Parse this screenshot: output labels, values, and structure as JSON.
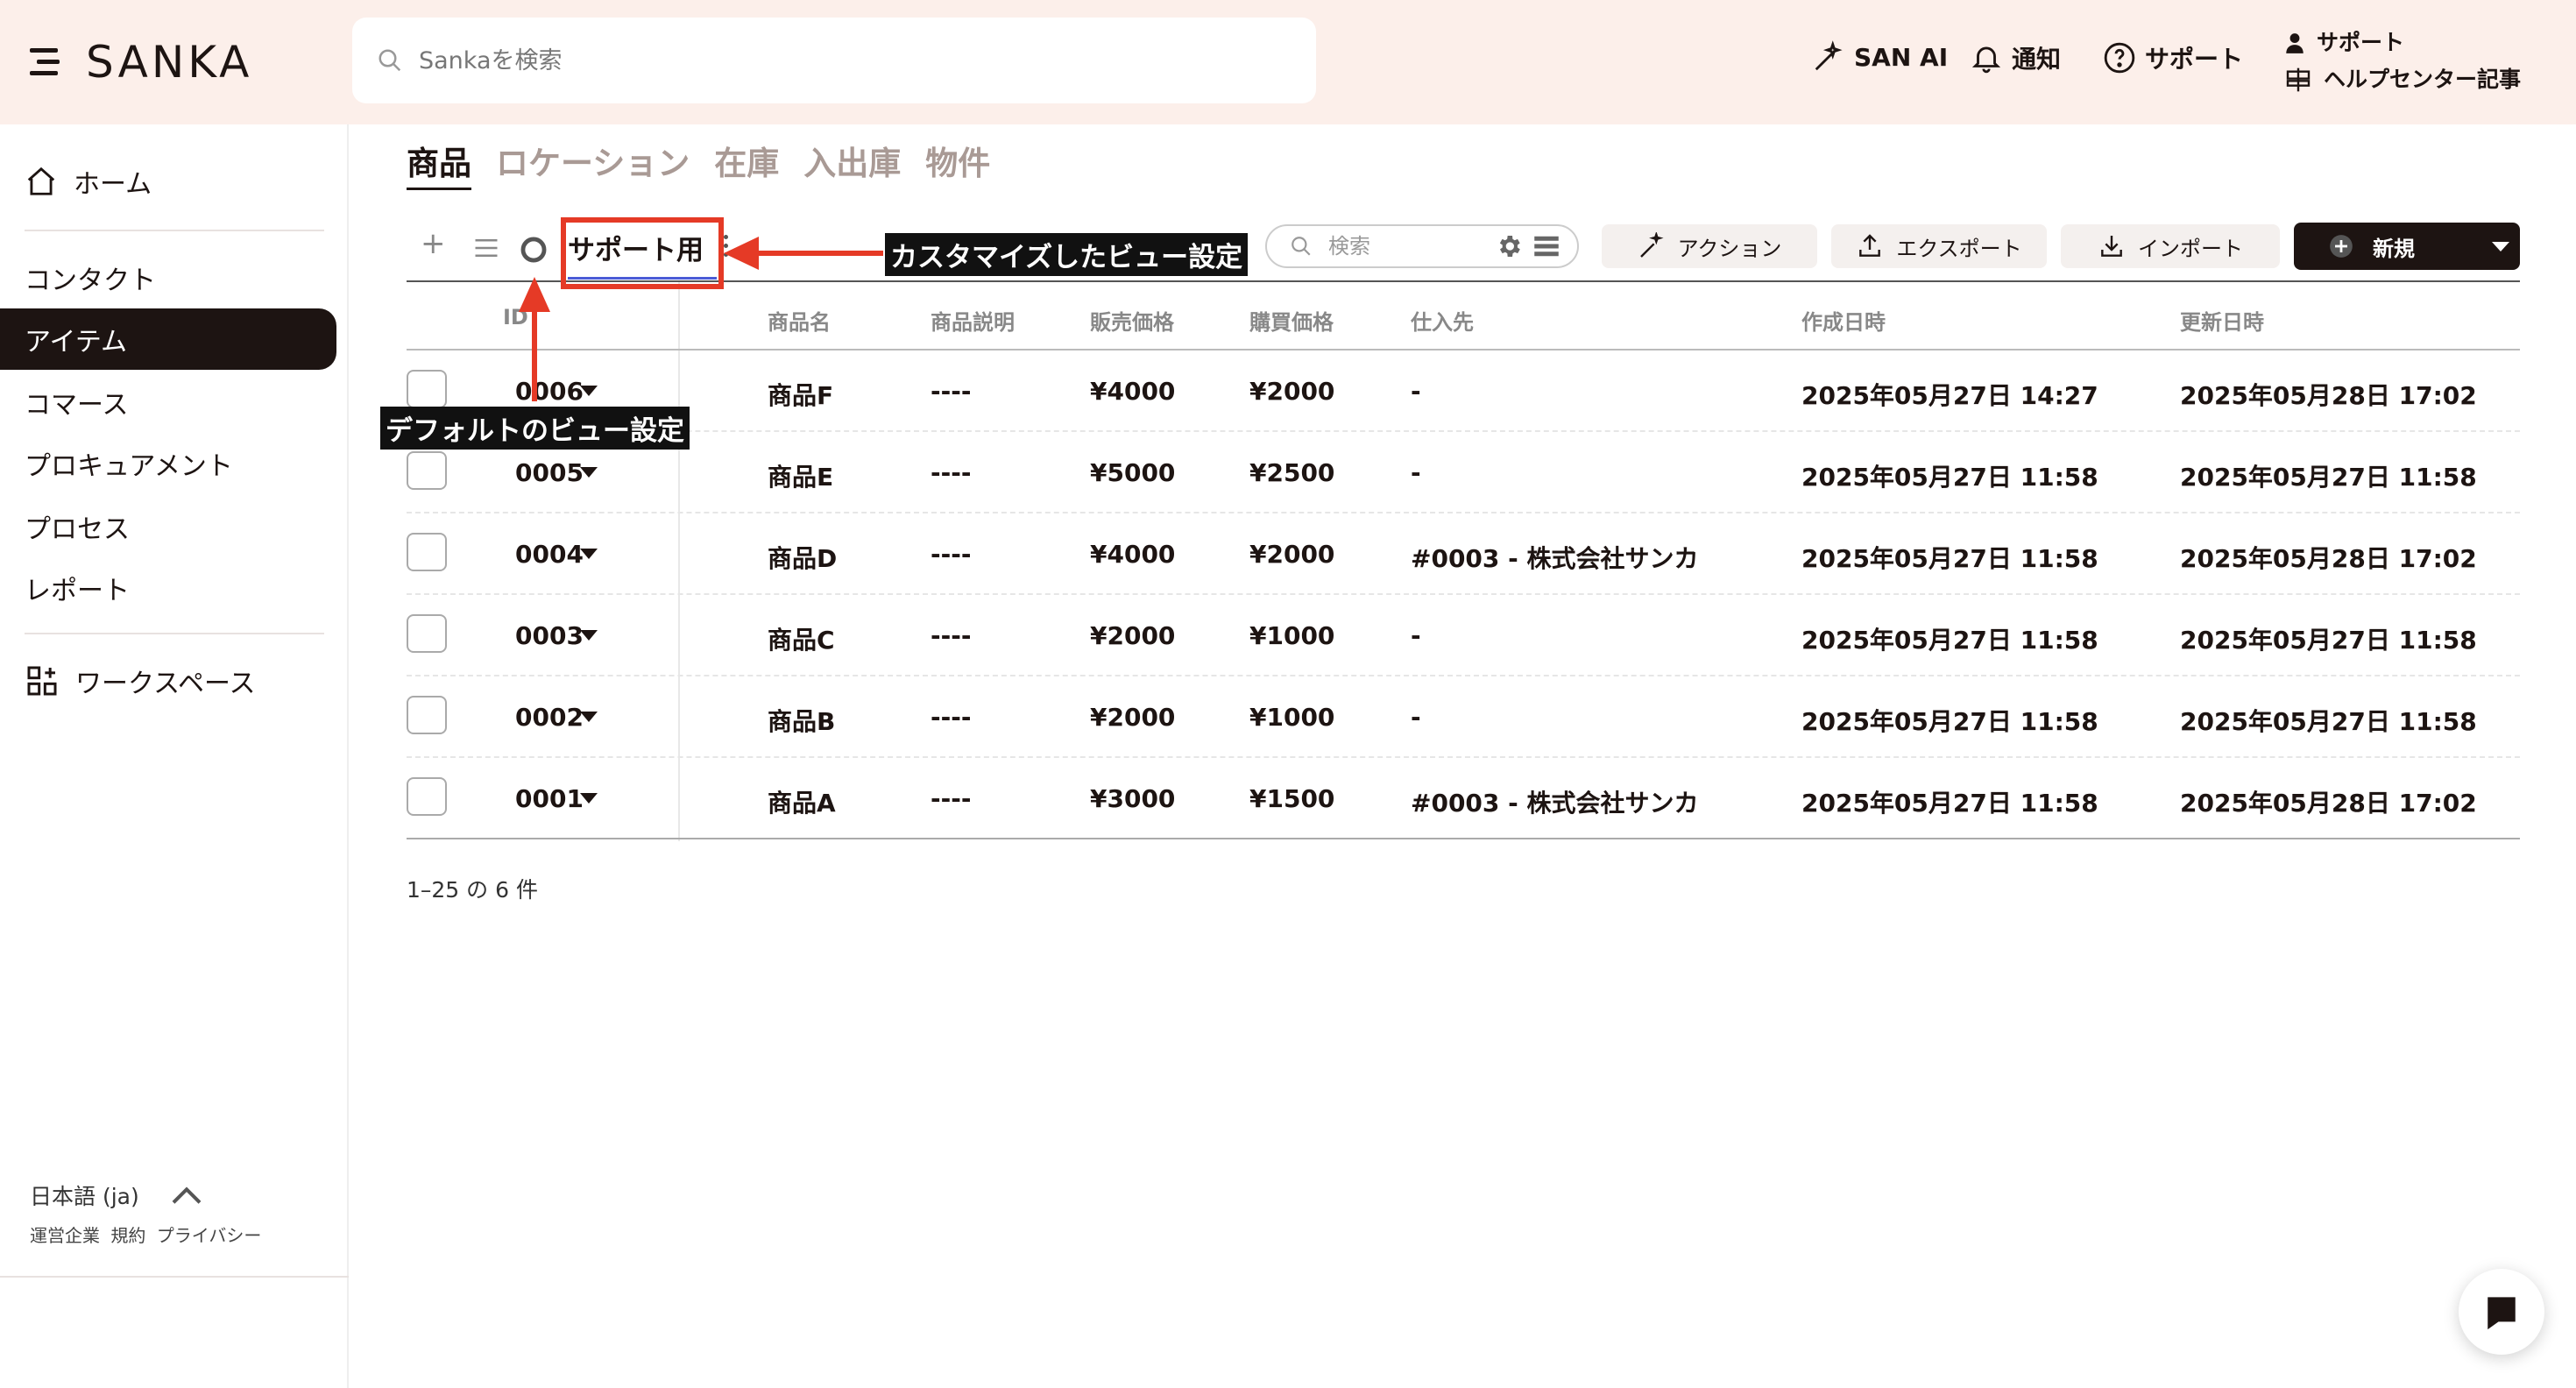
{
  "header": {
    "logo_text": "SANKA",
    "search_placeholder": "Sankaを検索",
    "san_ai": "SAN AI",
    "notifications": "通知",
    "support": "サポート",
    "support_block": {
      "line1": "サポート",
      "line2": "ヘルプセンター記事"
    }
  },
  "sidebar": {
    "items": [
      {
        "label": "ホーム",
        "icon": "home-icon"
      },
      {
        "label": "コンタクト"
      },
      {
        "label": "アイテム",
        "active": true
      },
      {
        "label": "コマース"
      },
      {
        "label": "プロキュアメント"
      },
      {
        "label": "プロセス"
      },
      {
        "label": "レポート"
      },
      {
        "label": "ワークスペース",
        "icon": "workspace-icon"
      }
    ],
    "language": "日本語 (ja)",
    "footer_links": [
      "運営企業",
      "規約",
      "プライバシー"
    ]
  },
  "tabs": [
    "商品",
    "ロケーション",
    "在庫",
    "入出庫",
    "物件"
  ],
  "toolbar": {
    "view_name": "サポート用",
    "search_placeholder": "検索",
    "action_label": "アクション",
    "export_label": "エクスポート",
    "import_label": "インポート",
    "new_label": "新規"
  },
  "table": {
    "headers": [
      "ID",
      "商品名",
      "商品説明",
      "販売価格",
      "購買価格",
      "仕入先",
      "作成日時",
      "更新日時"
    ],
    "rows": [
      [
        "0006",
        "商品F",
        "----",
        "¥4000",
        "¥2000",
        "-",
        "2025年05月27日 14:27",
        "2025年05月28日 17:02"
      ],
      [
        "0005",
        "商品E",
        "----",
        "¥5000",
        "¥2500",
        "-",
        "2025年05月27日 11:58",
        "2025年05月27日 11:58"
      ],
      [
        "0004",
        "商品D",
        "----",
        "¥4000",
        "¥2000",
        "#0003 - 株式会社サンカ",
        "2025年05月27日 11:58",
        "2025年05月28日 17:02"
      ],
      [
        "0003",
        "商品C",
        "----",
        "¥2000",
        "¥1000",
        "-",
        "2025年05月27日 11:58",
        "2025年05月27日 11:58"
      ],
      [
        "0002",
        "商品B",
        "----",
        "¥2000",
        "¥1000",
        "-",
        "2025年05月27日 11:58",
        "2025年05月27日 11:58"
      ],
      [
        "0001",
        "商品A",
        "----",
        "¥3000",
        "¥1500",
        "#0003 - 株式会社サンカ",
        "2025年05月27日 11:58",
        "2025年05月28日 17:02"
      ]
    ]
  },
  "pagination": "1–25 の 6 件",
  "annotations": {
    "custom_view": "カスタマイズしたビュー設定",
    "default_view": "デフォルトのビュー設定"
  },
  "colors": {
    "brand_dark": "#1d1412",
    "header_bg": "#fcefea",
    "annotation_red": "#e53a26"
  }
}
